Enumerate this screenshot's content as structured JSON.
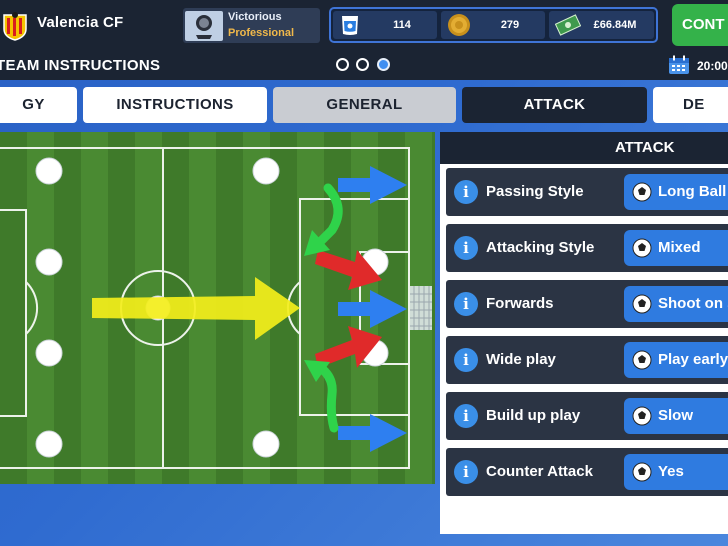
{
  "topbar": {
    "club_name": "Valencia CF",
    "status_line1": "Victorious",
    "status_line2": "Professional",
    "resources": [
      {
        "icon": "fans-icon",
        "value": "114"
      },
      {
        "icon": "coins-icon",
        "value": "279"
      },
      {
        "icon": "cash-icon",
        "value": "£66.84M"
      }
    ],
    "continue_label": "CONT"
  },
  "header": {
    "title": "TEAM INSTRUCTIONS",
    "pages": [
      false,
      false,
      true
    ],
    "time": "20:00"
  },
  "tabs": [
    {
      "label": "GY",
      "state": "light"
    },
    {
      "label": "INSTRUCTIONS",
      "state": "light"
    },
    {
      "label": "GENERAL",
      "state": "grey"
    },
    {
      "label": "ATTACK",
      "state": "dark"
    },
    {
      "label": "DE",
      "state": "light"
    }
  ],
  "panel": {
    "title": "ATTACK",
    "rows": [
      {
        "label": "Passing Style",
        "option": "Long Ball"
      },
      {
        "label": "Attacking Style",
        "option": "Mixed"
      },
      {
        "label": "Forwards",
        "option": "Shoot on si"
      },
      {
        "label": "Wide play",
        "option": "Play early c"
      },
      {
        "label": "Build up play",
        "option": "Slow"
      },
      {
        "label": "Counter Attack",
        "option": "Yes"
      }
    ]
  },
  "colors": {
    "accent_blue": "#2f7be0",
    "dark": "#1b2433",
    "continue_green": "#34b24a",
    "arrow_yellow": "#f3ee1a",
    "arrow_blue": "#2e7ff0",
    "arrow_red": "#e02a2a",
    "arrow_green": "#2fd34a"
  }
}
